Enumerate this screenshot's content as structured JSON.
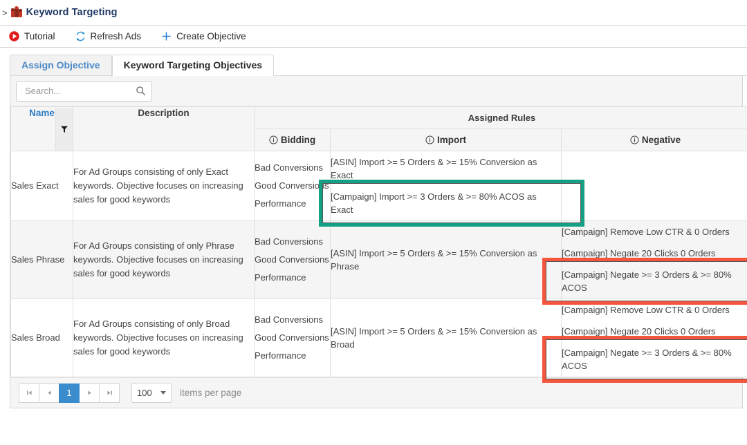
{
  "breadcrumb": {
    "caret": ">",
    "icon": "chess-pieces-icon",
    "title": "Keyword Targeting"
  },
  "toolbar": {
    "items": [
      {
        "label": "Tutorial",
        "icon": "play-circle-icon"
      },
      {
        "label": "Refresh Ads",
        "icon": "refresh-icon"
      },
      {
        "label": "Create Objective",
        "icon": "plus-icon"
      }
    ]
  },
  "tabs": [
    {
      "label": "Assign Objective",
      "active": false
    },
    {
      "label": "Keyword Targeting Objectives",
      "active": true
    }
  ],
  "search": {
    "value": "",
    "placeholder": "Search...",
    "icon": "search-icon"
  },
  "table": {
    "group_header": "Assigned Rules",
    "columns": {
      "name": "Name",
      "description": "Description",
      "bidding": "Bidding",
      "import": "Import",
      "negative": "Negative"
    },
    "rows": [
      {
        "name": "Sales Exact",
        "description": "For Ad Groups consisting of only Exact keywords. Objective focuses on increasing sales for good keywords",
        "bidding": [
          "Bad Conversions",
          "Good Conversions",
          "Performance"
        ],
        "import": [
          "[ASIN] Import >= 5 Orders & >= 15% Conversion as Exact",
          "[Campaign] Import >= 3 Orders & >= 80% ACOS as Exact"
        ],
        "negative": []
      },
      {
        "name": "Sales Phrase",
        "description": "For Ad Groups consisting of only Phrase keywords. Objective focuses on increasing sales for good keywords",
        "bidding": [
          "Bad Conversions",
          "Good Conversions",
          "Performance"
        ],
        "import": [
          "[ASIN] Import >= 5 Orders & >= 15% Conversion as Phrase"
        ],
        "negative": [
          "[Campaign] Remove Low CTR & 0 Orders",
          "[Campaign] Negate 20 Clicks 0 Orders",
          "[Campaign] Negate >= 3 Orders & >= 80% ACOS"
        ]
      },
      {
        "name": "Sales Broad",
        "description": "For Ad Groups consisting of only Broad keywords. Objective focuses on increasing sales for good keywords",
        "bidding": [
          "Bad Conversions",
          "Good Conversions",
          "Performance"
        ],
        "import": [
          "[ASIN] Import >= 5 Orders & >= 15% Conversion as Broad"
        ],
        "negative": [
          "[Campaign] Remove Low CTR & 0 Orders",
          "[Campaign] Negate 20 Clicks 0 Orders",
          "[Campaign] Negate >= 3 Orders & >= 80% ACOS"
        ]
      }
    ]
  },
  "pager": {
    "first": "|<",
    "prev": "<",
    "current_page": "1",
    "next": ">",
    "last": ">|",
    "page_size": "100",
    "page_size_label": "items per page"
  },
  "annotations": [
    {
      "name": "teal-highlight-import-exact",
      "color": "#13a085"
    },
    {
      "name": "red-highlight-negative-phrase",
      "color": "#f4553d"
    },
    {
      "name": "red-highlight-negative-broad",
      "color": "#f4553d"
    }
  ],
  "colors": {
    "accent_blue": "#3a8ccd",
    "title_blue": "#1f3864",
    "teal": "#13a085",
    "red": "#f4553d"
  }
}
